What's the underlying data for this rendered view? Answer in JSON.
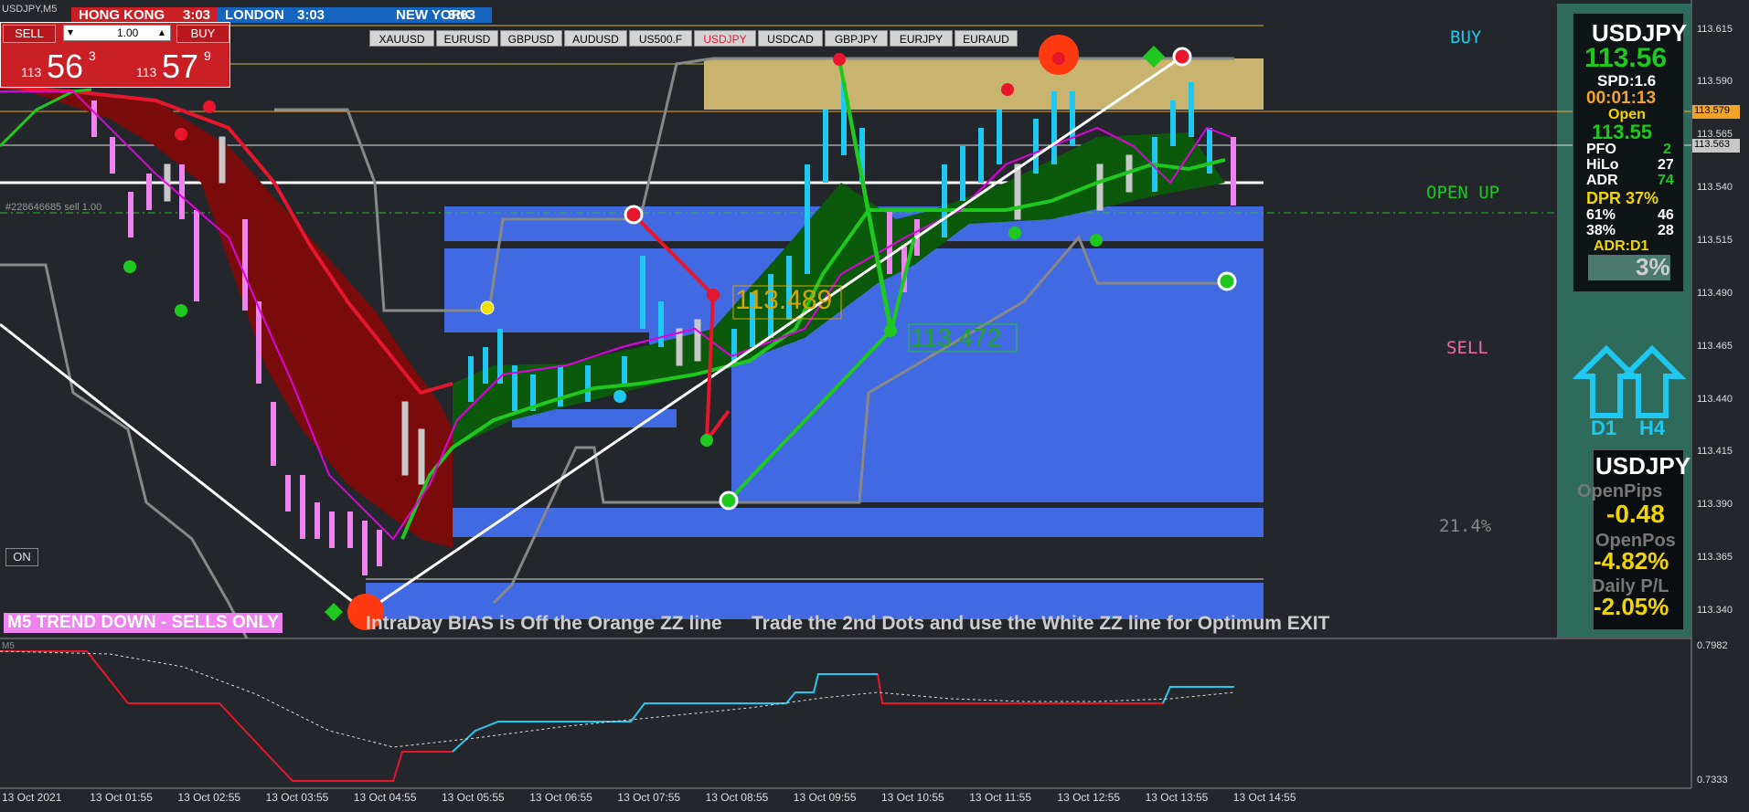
{
  "window_title": "USDJPY,M5",
  "trade_panel": {
    "sell_label": "SELL",
    "buy_label": "BUY",
    "lot": "1.00",
    "sell_small": "113",
    "sell_big": "56",
    "sell_sup": "3",
    "buy_small": "113",
    "buy_big": "57",
    "buy_sup": "9"
  },
  "sessions": {
    "hongkong": "HONG KONG",
    "hongkong_time": "3:03",
    "london": "LONDON",
    "london_time": "3:03",
    "newyork": "NEW YORK",
    "newyork_time": "3:03"
  },
  "symbols": [
    "XAUUSD",
    "EURUSD",
    "GBPUSD",
    "AUDUSD",
    "US500.F",
    "USDJPY",
    "USDCAD",
    "GBPJPY",
    "EURJPY",
    "EURAUD"
  ],
  "active_symbol": "USDJPY",
  "colors": {
    "bear_candle": "#ee82ee",
    "bull_candle": "#1ec8f0",
    "neutral_candle": "#c8c8c8",
    "zone_blue": "#4169e1",
    "zone_gold": "#c8b46e",
    "cloud_red": "#7a0b0b",
    "cloud_green": "#0b5a0b",
    "signal_red": "#e8162c",
    "signal_cyan": "#1ec8f0"
  },
  "order_line": "#228646685 sell 1.00",
  "on_button": "ON",
  "zz_labels": {
    "upper": "113.489",
    "lower": "113.472"
  },
  "signals": {
    "buy": "BUY",
    "open_up": "OPEN UP",
    "sell": "SELL",
    "percent": "21.4%"
  },
  "trend_banner": "M5  TREND DOWN - SELLS ONLY",
  "bias_text": "IntraDay BIAS is Off the Orange ZZ line",
  "trade_text": "Trade the 2nd Dots and use the White ZZ line for Optimum EXIT",
  "price_axis": [
    "113.615",
    "113.590",
    "113.565",
    "113.540",
    "113.515",
    "113.490",
    "113.465",
    "113.440",
    "113.415",
    "113.390",
    "113.365",
    "113.340"
  ],
  "price_tags": {
    "orange": "113.579",
    "current": "113.563"
  },
  "indicator_axis": {
    "top": "0.7982",
    "bottom": "0.7333",
    "name": "M5"
  },
  "time_axis": [
    "13 Oct 2021",
    "13 Oct 01:55",
    "13 Oct 02:55",
    "13 Oct 03:55",
    "13 Oct 04:55",
    "13 Oct 05:55",
    "13 Oct 06:55",
    "13 Oct 07:55",
    "13 Oct 08:55",
    "13 Oct 09:55",
    "13 Oct 10:55",
    "13 Oct 11:55",
    "13 Oct 12:55",
    "13 Oct 13:55",
    "13 Oct 14:55"
  ],
  "info": {
    "symbol": "USDJPY",
    "price": "113.56",
    "spread": "SPD:1.6",
    "timer": "00:01:13",
    "open_label": "Open",
    "open_price": "113.55",
    "pfo_label": "PFO",
    "pfo_val": "2",
    "hilo_label": "HiLo",
    "hilo_val": "27",
    "adr_label": "ADR",
    "adr_val": "74",
    "dpr": "DPR 37%",
    "p61_label": "61%",
    "p61_val": "46",
    "p38_label": "38%",
    "p38_val": "28",
    "adr_tf": "ADR:D1",
    "bar_pct": "3%",
    "d1": "D1",
    "h4": "H4"
  },
  "pl": {
    "symbol": "USDJPY",
    "open_pips_label": "OpenPips",
    "open_pips": "-0.48",
    "open_pos_label": "OpenPos",
    "open_pos": "-4.82%",
    "daily_label": "Daily P/L",
    "daily": "-2.05%"
  }
}
